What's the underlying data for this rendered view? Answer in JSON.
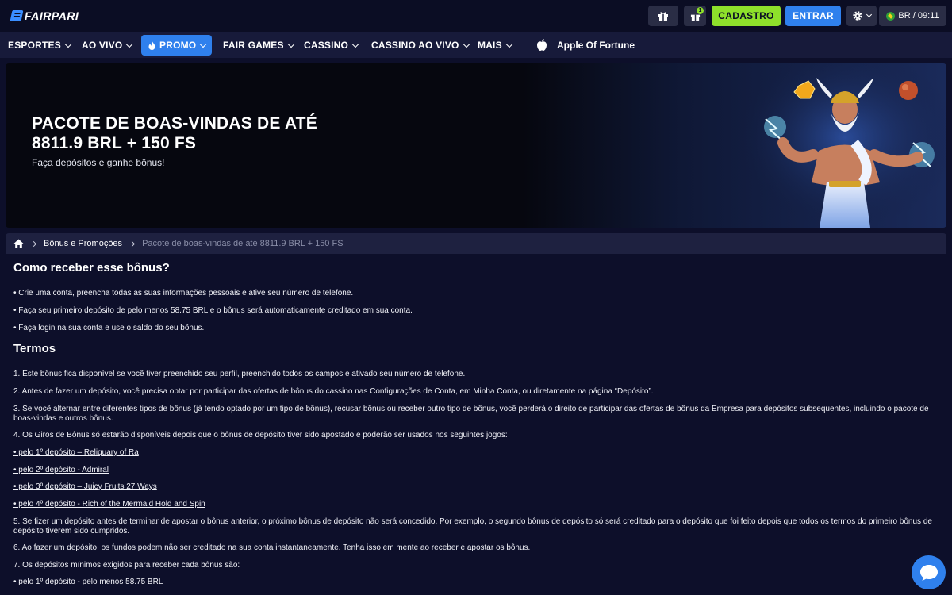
{
  "header": {
    "logo_text": "FAIRPARI",
    "gift_badge": "1",
    "signup_label": "CADASTRO",
    "login_label": "ENTRAR",
    "locale_label": "BR / 09:11"
  },
  "nav": {
    "items": [
      {
        "label": "ESPORTES"
      },
      {
        "label": "AO VIVO"
      },
      {
        "label": "PROMO"
      },
      {
        "label": "FAIR GAMES"
      },
      {
        "label": "CASSINO"
      },
      {
        "label": "CASSINO AO VIVO"
      },
      {
        "label": "MAIS"
      }
    ],
    "app_label": "Apple Of Fortune"
  },
  "banner": {
    "title_line1": "PACOTE DE BOAS-VINDAS DE ATÉ",
    "title_line2": "8811.9 BRL + 150 FS",
    "subtitle": "Faça depósitos e ganhe bônus!"
  },
  "breadcrumb": {
    "section": "Bônus e Promoções",
    "current": "Pacote de boas-vindas de até 8811.9 BRL + 150 FS"
  },
  "how": {
    "title": "Como receber esse bônus?",
    "steps": [
      "• Crie uma conta, preencha todas as suas informações pessoais e ative seu número de telefone.",
      "• Faça seu primeiro depósito de pelo menos 58.75 BRL e o bônus será automaticamente creditado em sua conta.",
      "• Faça login na sua conta e use o saldo do seu bônus."
    ]
  },
  "terms": {
    "title": "Termos",
    "items": [
      "1. Este bônus fica disponível se você tiver preenchido seu perfil, preenchido todos os campos e ativado seu número de telefone.",
      "2. Antes de fazer um depósito, você precisa optar por participar das ofertas de bônus do cassino nas Configurações de Conta, em Minha Conta, ou diretamente na página “Depósito”.",
      "3. Se você alternar entre diferentes tipos de bônus (já tendo optado por um tipo de bônus), recusar bônus ou receber outro tipo de bônus, você perderá o direito de participar das ofertas de bônus da Empresa para depósitos subsequentes, incluindo o pacote de boas-vindas e outros bônus.",
      "4. Os Giros de Bônus só estarão disponíveis depois que o bônus de depósito tiver sido apostado e poderão ser usados nos seguintes jogos:",
      "• pelo 1º depósito – Reliquary of Ra",
      "• pelo 2º depósito - Admiral",
      "• pelo 3º depósito – Juicy Fruits 27 Ways",
      "• pelo 4º depósito - Rich of the Mermaid Hold and Spin",
      "5. Se fizer um depósito antes de terminar de apostar o bônus anterior, o próximo bônus de depósito não será concedido. Por exemplo, o segundo bônus de depósito só será creditado para o depósito que foi feito depois que todos os termos do primeiro bônus de depósito tiverem sido cumpridos.",
      "6. Ao fazer um depósito, os fundos podem não ser creditado na sua conta instantaneamente. Tenha isso em mente ao receber e apostar os bônus.",
      "7. Os depósitos mínimos exigidos para receber cada bônus são:",
      "• pelo 1º depósito - pelo menos 58.75 BRL"
    ]
  },
  "colors": {
    "background": "#0d0f2a",
    "nav": "#171a3a",
    "accent_blue": "#2f80ed",
    "accent_green": "#8ee02b"
  }
}
